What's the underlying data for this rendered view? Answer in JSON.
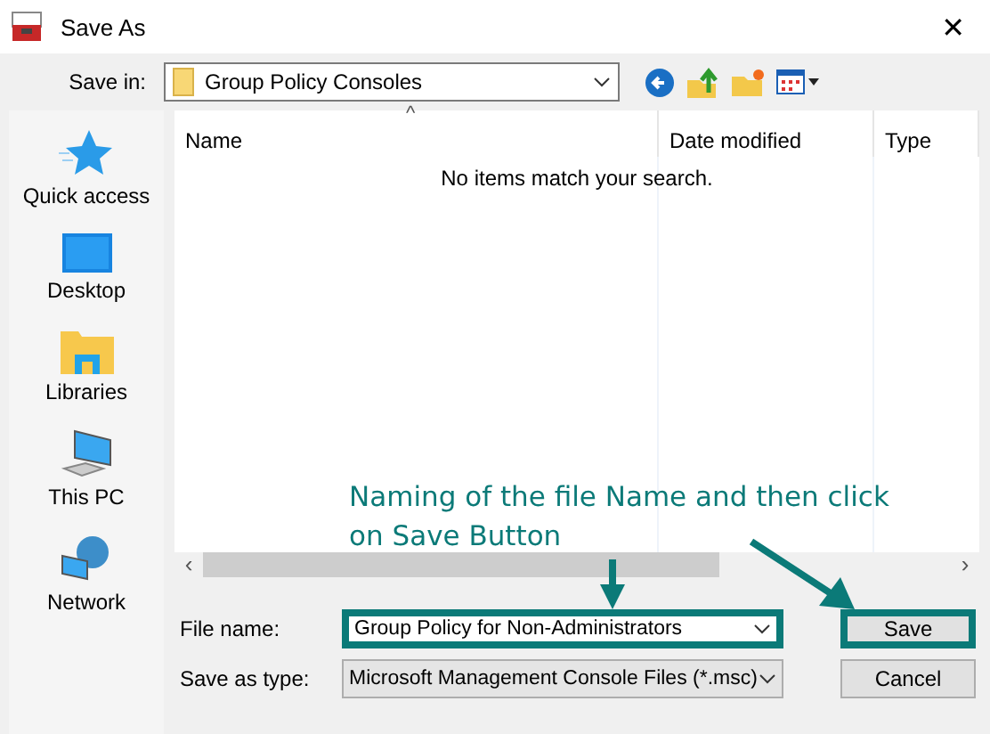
{
  "window": {
    "title": "Save As",
    "close": "✕"
  },
  "save_in": {
    "label": "Save in:",
    "value": "Group Policy Consoles"
  },
  "places": [
    {
      "kind": "star",
      "label": "Quick access"
    },
    {
      "kind": "desktop",
      "label": "Desktop"
    },
    {
      "kind": "libraries",
      "label": "Libraries"
    },
    {
      "kind": "pc",
      "label": "This PC"
    },
    {
      "kind": "network",
      "label": "Network"
    }
  ],
  "file_list": {
    "columns": [
      "Name",
      "Date modified",
      "Type"
    ],
    "sort_caret": "^",
    "empty_message": "No items match your search."
  },
  "scrollbar": {
    "left": "‹",
    "right": "›"
  },
  "file_name": {
    "label": "File name:",
    "value": "Group Policy for Non-Administrators",
    "highlighted": true
  },
  "save_as_type": {
    "label": "Save as type:",
    "value": "Microsoft Management Console Files (*.msc)"
  },
  "buttons": [
    {
      "label": "Save",
      "highlighted": true
    },
    {
      "label": "Cancel",
      "highlighted": false
    }
  ],
  "annotation": {
    "text": "Naming of the file Name and then click on Save Button"
  }
}
